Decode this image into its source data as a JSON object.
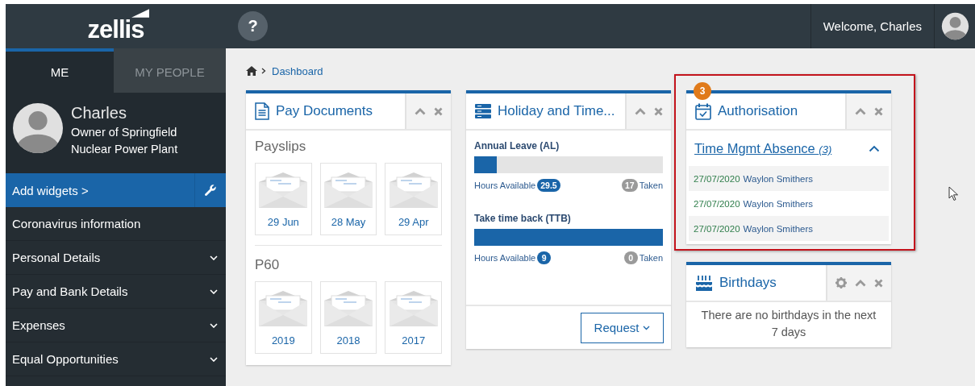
{
  "header": {
    "logo": "zellis",
    "help": "?",
    "welcome": "Welcome, Charles"
  },
  "sidebar": {
    "tabs": [
      {
        "label": "ME",
        "selected": true
      },
      {
        "label": "MY PEOPLE",
        "selected": false
      }
    ],
    "profile": {
      "name": "Charles",
      "role": "Owner of Springfield Nuclear Power Plant"
    },
    "add_widgets": "Add widgets >",
    "items": [
      {
        "label": "Coronavirus information",
        "kind": "link"
      },
      {
        "label": "Personal Details",
        "kind": "menu"
      },
      {
        "label": "Pay and Bank Details",
        "kind": "menu"
      },
      {
        "label": "Expenses",
        "kind": "menu"
      },
      {
        "label": "Equal Opportunities",
        "kind": "menu"
      }
    ]
  },
  "breadcrumb": {
    "current": "Dashboard"
  },
  "columns": [
    [
      {
        "kind": "documents",
        "title": "Pay Documents",
        "highlighted": false,
        "sections": [
          {
            "title": "Payslips",
            "items": [
              "29 Jun",
              "28 May",
              "29 Apr"
            ]
          },
          {
            "title": "P60",
            "items": [
              "2019",
              "2018",
              "2017"
            ]
          }
        ]
      }
    ],
    [
      {
        "kind": "balances",
        "title": "Holiday and Time...",
        "highlighted": false,
        "balances": [
          {
            "label": "Annual Leave (AL)",
            "level": 0.12,
            "available_label": "Hours Available",
            "available": "29.5",
            "taken": "17",
            "taken_label": "Taken"
          },
          {
            "label": "Take time back (TTB)",
            "level": 1,
            "available_label": "Hours Available",
            "available": "9",
            "taken": "0",
            "taken_label": "Taken"
          }
        ],
        "button": "Request"
      }
    ],
    [
      {
        "kind": "authorisation",
        "title": "Authorisation",
        "highlighted": true,
        "badge": "3",
        "group": {
          "title": "Time Mgmt Absence",
          "count": "(3)",
          "expanded": true,
          "rows": [
            {
              "date": "27/07/2020",
              "name": "Waylon Smithers"
            },
            {
              "date": "27/07/2020",
              "name": "Waylon Smithers"
            },
            {
              "date": "27/07/2020",
              "name": "Waylon Smithers"
            }
          ]
        }
      },
      {
        "kind": "birthdays",
        "title": "Birthdays",
        "settings_button": true,
        "highlighted": false,
        "message": "There are no birthdays in the next 7 days"
      }
    ]
  ]
}
